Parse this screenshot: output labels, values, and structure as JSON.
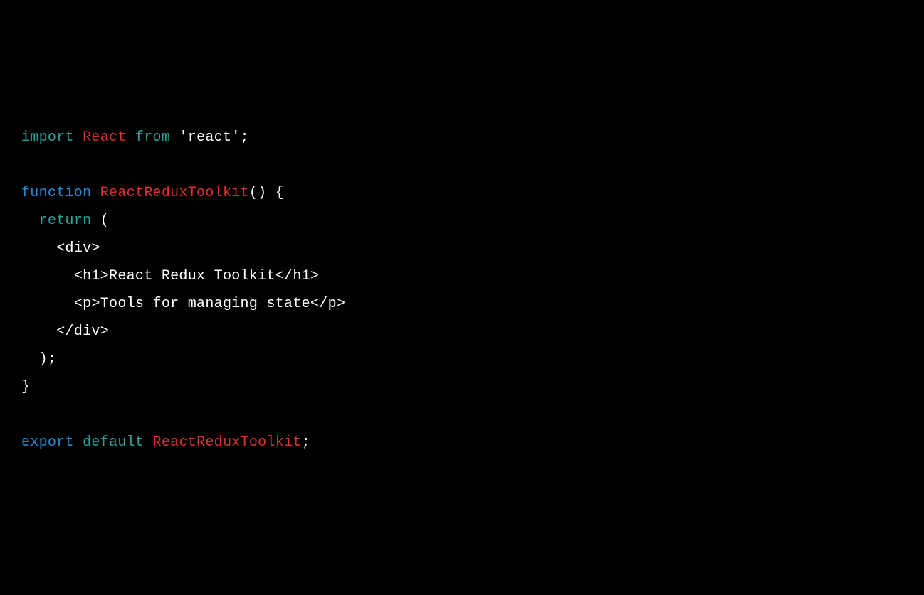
{
  "code": {
    "line1": {
      "import": "import",
      "react": "React",
      "from": "from",
      "reactStr": "'react'",
      "semi": ";"
    },
    "line3": {
      "function": "function",
      "name": "ReactReduxToolkit",
      "parens": "()",
      "brace": " {"
    },
    "line4": {
      "return": "return",
      "paren": " ("
    },
    "line5": {
      "divOpen": "<div>"
    },
    "line6": {
      "h1": "<h1>React Redux Toolkit</h1>"
    },
    "line7": {
      "p": "<p>Tools for managing state</p>"
    },
    "line8": {
      "divClose": "</div>"
    },
    "line9": {
      "close": ");"
    },
    "line10": {
      "brace": "}"
    },
    "line12": {
      "export": "export",
      "default": "default",
      "name": "ReactReduxToolkit",
      "semi": ";"
    }
  }
}
